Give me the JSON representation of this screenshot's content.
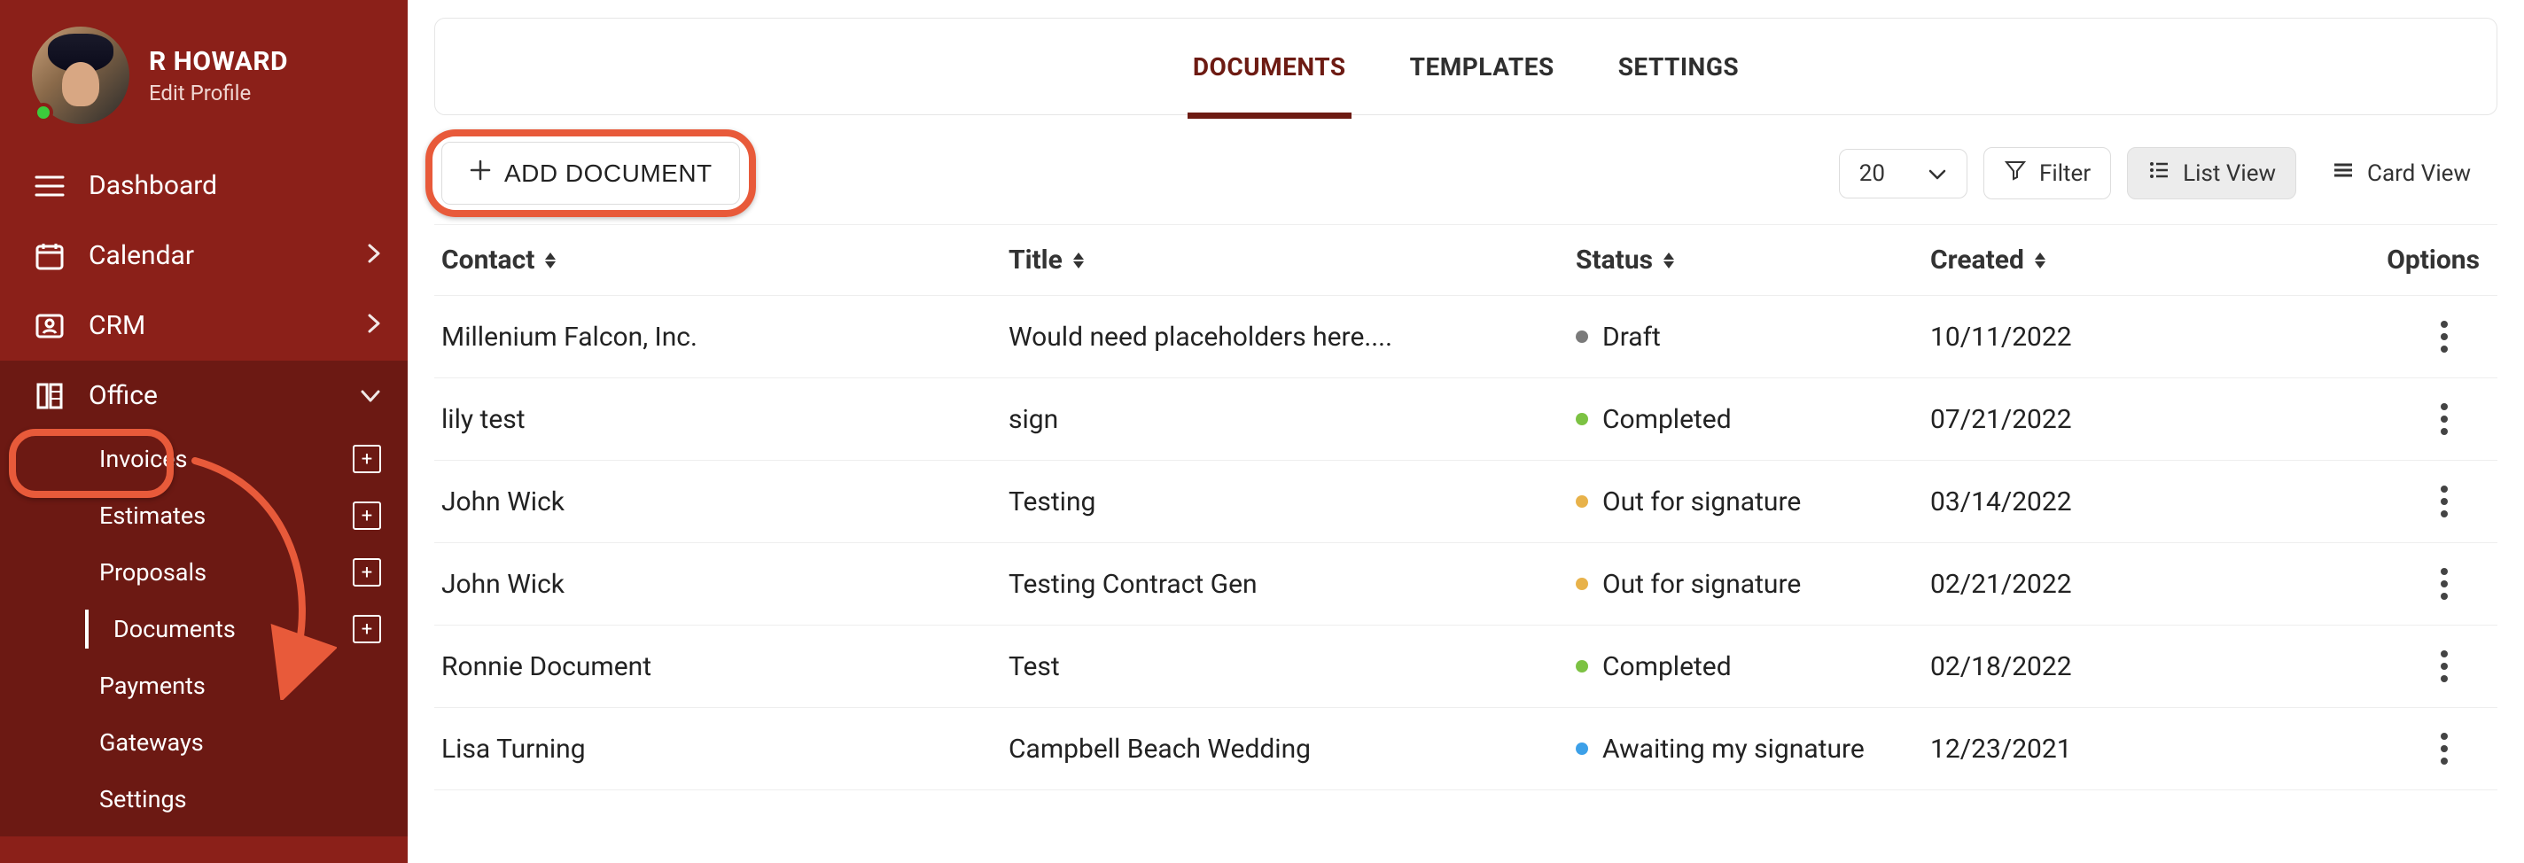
{
  "user": {
    "name": "R HOWARD",
    "edit_label": "Edit Profile"
  },
  "sidebar": {
    "dashboard": "Dashboard",
    "calendar": "Calendar",
    "crm": "CRM",
    "office": "Office",
    "sub": {
      "invoices": "Invoices",
      "estimates": "Estimates",
      "proposals": "Proposals",
      "documents": "Documents",
      "payments": "Payments",
      "gateways": "Gateways",
      "settings": "Settings"
    }
  },
  "tabs": {
    "documents": "DOCUMENTS",
    "templates": "TEMPLATES",
    "settings": "SETTINGS"
  },
  "toolbar": {
    "add_document": "ADD DOCUMENT",
    "page_size": "20",
    "filter": "Filter",
    "list_view": "List View",
    "card_view": "Card View"
  },
  "columns": {
    "contact": "Contact",
    "title": "Title",
    "status": "Status",
    "created": "Created",
    "options": "Options"
  },
  "status_labels": {
    "draft": "Draft",
    "completed": "Completed",
    "out_for_signature": "Out for signature",
    "awaiting_my_signature": "Awaiting my signature"
  },
  "rows": [
    {
      "contact": "Millenium Falcon, Inc.",
      "title": "Would need placeholders here....",
      "status": "draft",
      "dot": "gray",
      "created": "10/11/2022"
    },
    {
      "contact": "lily test",
      "title": "sign",
      "status": "completed",
      "dot": "green",
      "created": "07/21/2022"
    },
    {
      "contact": "John Wick",
      "title": "Testing",
      "status": "out_for_signature",
      "dot": "amber",
      "created": "03/14/2022"
    },
    {
      "contact": "John Wick",
      "title": "Testing Contract Gen",
      "status": "out_for_signature",
      "dot": "amber",
      "created": "02/21/2022"
    },
    {
      "contact": "Ronnie Document",
      "title": "Test",
      "status": "completed",
      "dot": "green",
      "created": "02/18/2022"
    },
    {
      "contact": "Lisa Turning",
      "title": "Campbell Beach Wedding",
      "status": "awaiting_my_signature",
      "dot": "blue",
      "created": "12/23/2021"
    }
  ]
}
